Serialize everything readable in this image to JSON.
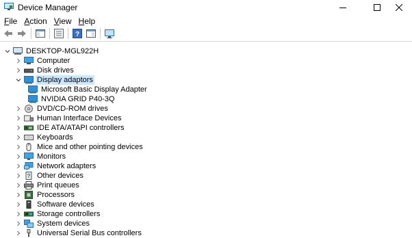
{
  "window": {
    "title": "Device Manager"
  },
  "menu": [
    {
      "accel": "F",
      "rest": "ile"
    },
    {
      "accel": "A",
      "rest": "ction"
    },
    {
      "accel": "V",
      "rest": "iew"
    },
    {
      "accel": "H",
      "rest": "elp"
    }
  ],
  "tree": {
    "root": "DESKTOP-MGL922H",
    "categories": [
      {
        "label": "Computer",
        "icon": "computer-icon"
      },
      {
        "label": "Disk drives",
        "icon": "disk-drive-icon"
      },
      {
        "label": "Display adaptors",
        "icon": "display-adapter-icon",
        "expanded": true,
        "selected": true,
        "children": [
          {
            "label": "Microsoft Basic Display Adapter",
            "icon": "display-adapter-icon"
          },
          {
            "label": "NVIDIA GRID P40-3Q",
            "icon": "display-adapter-icon"
          }
        ]
      },
      {
        "label": "DVD/CD-ROM drives",
        "icon": "dvd-icon"
      },
      {
        "label": "Human Interface Devices",
        "icon": "hid-icon"
      },
      {
        "label": "IDE ATA/ATAPI controllers",
        "icon": "ide-controller-icon"
      },
      {
        "label": "Keyboards",
        "icon": "keyboard-icon"
      },
      {
        "label": "Mice and other pointing devices",
        "icon": "mouse-icon"
      },
      {
        "label": "Monitors",
        "icon": "monitor-icon"
      },
      {
        "label": "Network adapters",
        "icon": "network-adapter-icon"
      },
      {
        "label": "Other devices",
        "icon": "unknown-device-icon"
      },
      {
        "label": "Print queues",
        "icon": "printer-icon"
      },
      {
        "label": "Processors",
        "icon": "processor-icon"
      },
      {
        "label": "Software devices",
        "icon": "software-device-icon"
      },
      {
        "label": "Storage controllers",
        "icon": "storage-controller-icon"
      },
      {
        "label": "System devices",
        "icon": "system-device-icon"
      },
      {
        "label": "Universal Serial Bus controllers",
        "icon": "usb-icon"
      }
    ]
  }
}
